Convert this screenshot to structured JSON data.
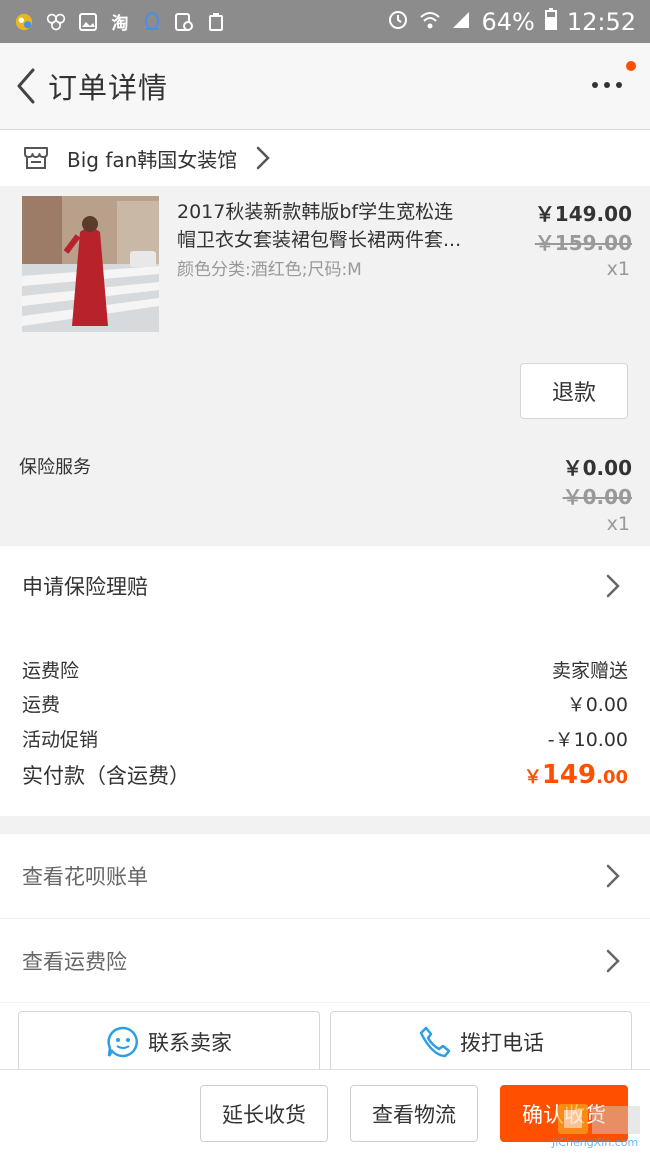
{
  "status_bar": {
    "battery": "64%",
    "time": "12:52"
  },
  "nav": {
    "title": "订单详情"
  },
  "shop": {
    "name": "Big fan韩国女装馆"
  },
  "product": {
    "title_line1": "2017秋装新款韩版bf学生宽松连",
    "title_line2": "帽卫衣女套装裙包臀长裙两件套...",
    "sku": "颜色分类:酒红色;尺码:M",
    "price": "￥149.00",
    "original_price": "￥159.00",
    "quantity": "x1",
    "refund_label": "退款"
  },
  "insurance": {
    "label": "保险服务",
    "price": "￥0.00",
    "original_price": "￥0.00",
    "quantity": "x1"
  },
  "claim": {
    "label": "申请保险理赔"
  },
  "fees": [
    {
      "label": "运费险",
      "value": "卖家赠送"
    },
    {
      "label": "运费",
      "value": "￥0.00"
    },
    {
      "label": "活动促销",
      "value": "-￥10.00"
    }
  ],
  "total": {
    "label": "实付款（含运费）",
    "yen": "￥",
    "integer": "149",
    "decimal": ".00"
  },
  "links": [
    {
      "label": "查看花呗账单"
    },
    {
      "label": "查看运费险"
    }
  ],
  "contact": {
    "seller_label": "联系卖家",
    "phone_label": "拨打电话"
  },
  "bottom": {
    "extend_label": "延长收货",
    "logistics_label": "查看物流",
    "confirm_label": "确认收货"
  },
  "watermark": {
    "text": "JiChengXin.com"
  },
  "colors": {
    "accent": "#ff5000",
    "status_bar": "#8c8c8c",
    "contact_icon": "#2b9ee6"
  },
  "icons": [
    "back-icon",
    "more-icon",
    "shop-icon",
    "chevron-right-icon",
    "smile-chat-icon",
    "phone-icon"
  ]
}
